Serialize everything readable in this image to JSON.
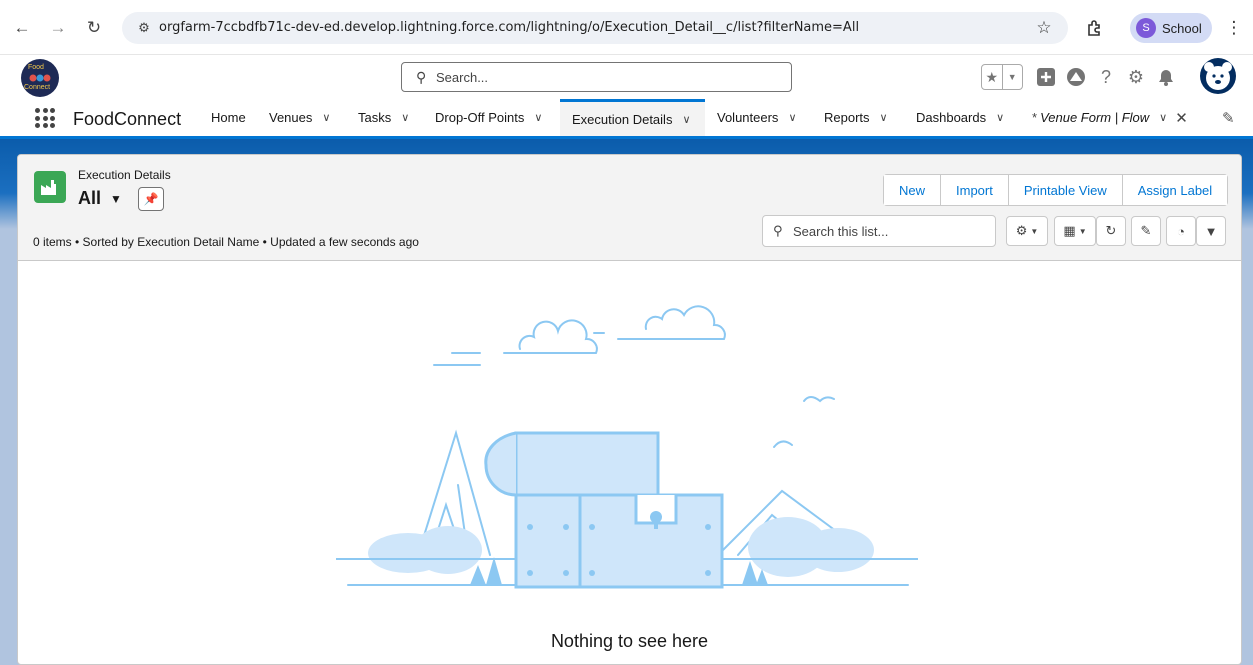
{
  "browser": {
    "url": "orgfarm-7ccbdfb71c-dev-ed.develop.lightning.force.com/lightning/o/Execution_Detail__c/list?filterName=All",
    "profile_initial": "S",
    "profile_name": "School"
  },
  "global_header": {
    "logo_top": "Food",
    "logo_bottom": "Connect",
    "search_placeholder": "Search..."
  },
  "app_nav": {
    "app_name": "FoodConnect",
    "tabs": [
      {
        "label": "Home"
      },
      {
        "label": "Venues"
      },
      {
        "label": "Tasks"
      },
      {
        "label": "Drop-Off Points"
      },
      {
        "label": "Execution Details"
      },
      {
        "label": "Volunteers"
      },
      {
        "label": "Reports"
      },
      {
        "label": "Dashboards"
      },
      {
        "label": "Venue Form | Flow",
        "dirty_marker": "*"
      }
    ]
  },
  "list_view": {
    "object_label": "Execution Details",
    "view_name": "All",
    "actions": [
      "New",
      "Import",
      "Printable View",
      "Assign Label"
    ],
    "meta": "0 items • Sorted by Execution Detail Name • Updated a few seconds ago",
    "search_placeholder": "Search this list...",
    "empty_message": "Nothing to see here"
  },
  "colors": {
    "brand_blue": "#0176d3",
    "object_icon_green": "#3ba755",
    "illustration_blue": "#8cc8f2",
    "illustration_fill": "#cfe6fa"
  }
}
